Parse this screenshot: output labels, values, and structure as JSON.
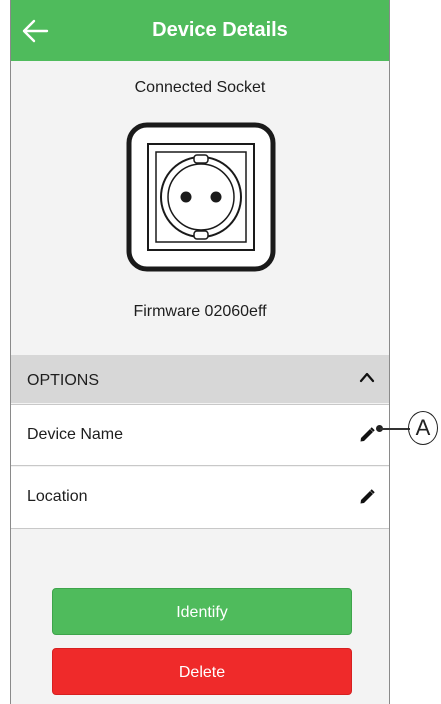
{
  "header": {
    "title": "Device Details",
    "back_icon": "arrow-left-icon",
    "color": "#4fbb5c"
  },
  "device": {
    "type_label": "Connected Socket",
    "illustration_icon": "power-socket-icon",
    "firmware": "Firmware 02060eff"
  },
  "options": {
    "label": "OPTIONS",
    "toggle_icon": "chevron-up-icon",
    "rows": [
      {
        "label": "Device Name",
        "icon": "pencil-icon"
      },
      {
        "label": "Location",
        "icon": "pencil-icon"
      }
    ]
  },
  "buttons": {
    "identify": "Identify",
    "delete": "Delete",
    "identify_color": "#4fbb5c",
    "delete_color": "#ef2a2a"
  },
  "callout": {
    "label": "A"
  }
}
